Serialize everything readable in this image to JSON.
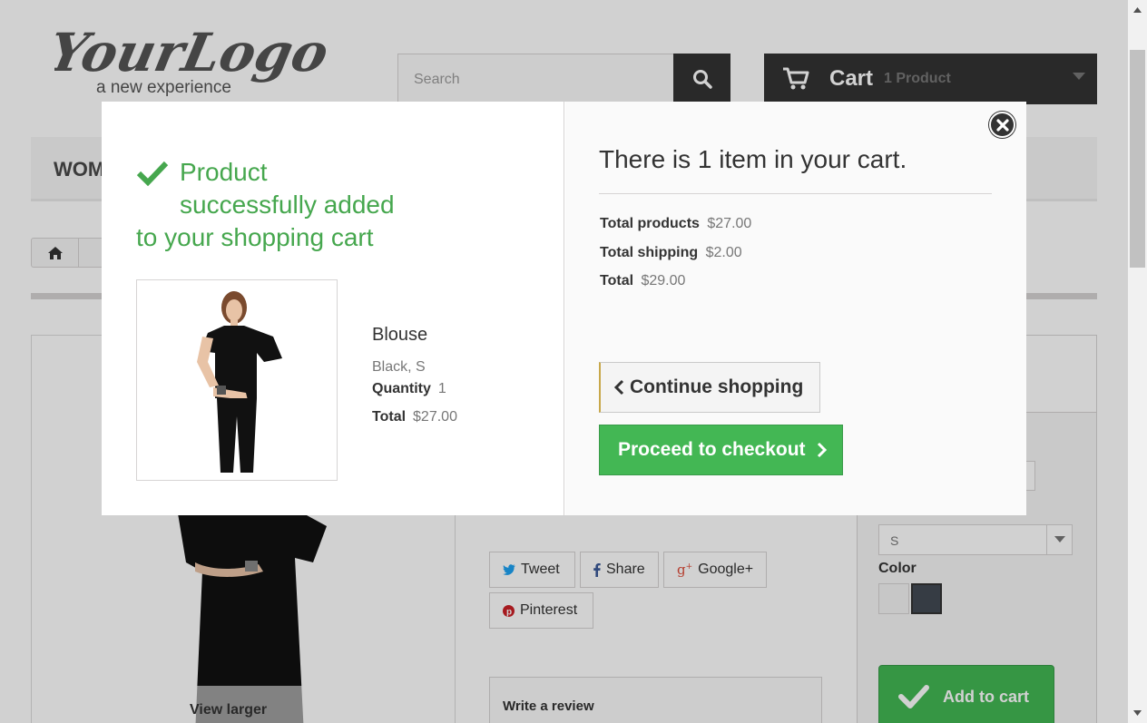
{
  "header": {
    "logo_brand": "YourLogo",
    "logo_tagline": "a new experience",
    "search_placeholder": "Search",
    "cart_label": "Cart",
    "cart_count": "1 Product"
  },
  "menu": {
    "first_item": "WOM"
  },
  "product_page": {
    "view_larger": "View larger",
    "social": {
      "tweet": "Tweet",
      "share": "Share",
      "google": "Google+",
      "pinterest": "Pinterest"
    },
    "write_review": "Write a review",
    "size_selected": "S",
    "color_label": "Color",
    "add_to_cart": "Add to cart",
    "colors": {
      "swatch1": "#f3f3f3",
      "swatch2": "#434a54"
    }
  },
  "modal": {
    "success_line1": "Product",
    "success_line2": "successfully added",
    "success_line3": "to your shopping cart",
    "product_name": "Blouse",
    "product_attributes": "Black, S",
    "quantity_label": "Quantity",
    "quantity_value": "1",
    "total_label": "Total",
    "total_value": "$27.00",
    "cart_title": "There is 1 item in your cart.",
    "summary": {
      "products_label": "Total products",
      "products_value": "$27.00",
      "shipping_label": "Total shipping",
      "shipping_value": "$2.00",
      "total_label": "Total",
      "total_value": "$29.00"
    },
    "continue_label": "Continue shopping",
    "checkout_label": "Proceed to checkout"
  },
  "colors": {
    "success_green": "#46a74e",
    "checkout_green": "#43b754",
    "dark": "#333333"
  }
}
